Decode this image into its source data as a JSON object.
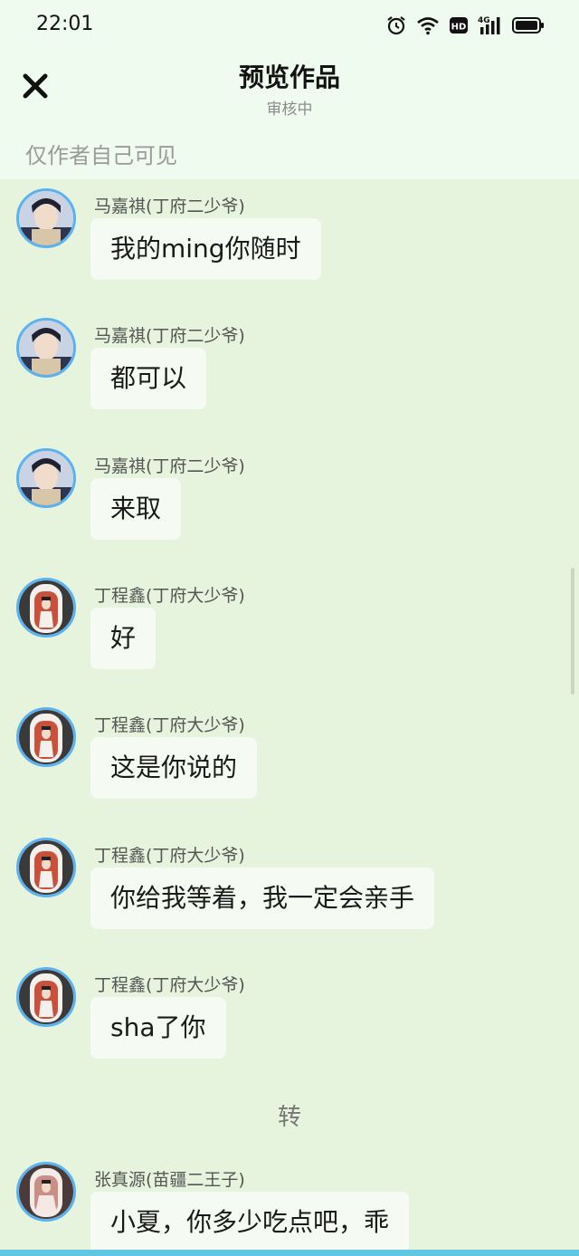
{
  "status_bar": {
    "time": "22:01",
    "icons": [
      "alarm-icon",
      "wifi-icon",
      "hd-icon",
      "signal-4g-icon",
      "battery-icon"
    ]
  },
  "header": {
    "title": "预览作品",
    "subtitle": "审核中",
    "close_icon": "close-icon",
    "visibility_note": "仅作者自己可见"
  },
  "messages": [
    {
      "sender": "马嘉祺(丁府二少爷)",
      "text": "我的ming你随时",
      "avatar": "avatar-majiaqi"
    },
    {
      "sender": "马嘉祺(丁府二少爷)",
      "text": "都可以",
      "avatar": "avatar-majiaqi"
    },
    {
      "sender": "马嘉祺(丁府二少爷)",
      "text": "来取",
      "avatar": "avatar-majiaqi"
    },
    {
      "sender": "丁程鑫(丁府大少爷)",
      "text": "好",
      "avatar": "avatar-dingchengxin"
    },
    {
      "sender": "丁程鑫(丁府大少爷)",
      "text": "这是你说的",
      "avatar": "avatar-dingchengxin"
    },
    {
      "sender": "丁程鑫(丁府大少爷)",
      "text": "你给我等着，我一定会亲手",
      "avatar": "avatar-dingchengxin"
    },
    {
      "sender": "丁程鑫(丁府大少爷)",
      "text": "sha了你",
      "avatar": "avatar-dingchengxin"
    },
    {
      "sender": "张真源(苗疆二王子)",
      "text": "小夏，你多少吃点吧，乖",
      "avatar": "avatar-zhangzhenyuan"
    }
  ],
  "divider": "转",
  "colors": {
    "background": "#e6f4dd",
    "header_background": "#f0fbf0",
    "bubble": "#f5fbf3",
    "avatar_ring": "#5bb2ef"
  }
}
